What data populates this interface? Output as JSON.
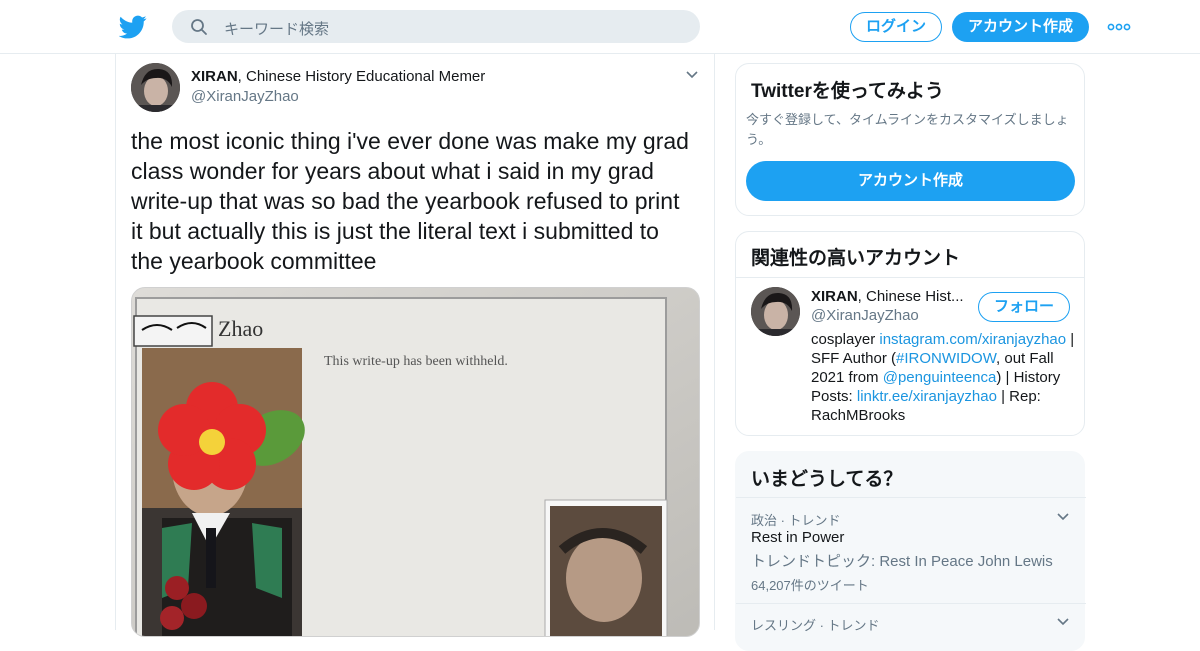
{
  "header": {
    "search_placeholder": "キーワード検索",
    "login_label": "ログイン",
    "signup_label": "アカウント作成",
    "brand_color": "#1da1f2"
  },
  "tweet": {
    "author_name": "XIRAN",
    "author_subtitle": ", Chinese History Educational Memer",
    "author_handle": "@XiranJayZhao",
    "text": "the most iconic thing i've ever done was make my grad class wonder for years about what i said in my grad write-up that was so bad the yearbook refused to print it but actually this is just the literal text i submitted to the yearbook committee",
    "photo": {
      "caption_name": "Zhao",
      "caption_text": "This write-up has been withheld."
    }
  },
  "try_twitter": {
    "title": "Twitterを使ってみよう",
    "description": "今すぐ登録して、タイムラインをカスタマイズしましょう。",
    "button_label": "アカウント作成"
  },
  "related": {
    "title": "関連性の高いアカウント",
    "account": {
      "name": "XIRAN",
      "name_suffix": ", Chinese Hist...",
      "handle": "@XiranJayZhao",
      "follow_label": "フォロー",
      "bio_1": "cosplayer ",
      "bio_link_1": "instagram.com/xiranjayzhao",
      "bio_2": " | SFF Author (",
      "bio_link_2": "#IRONWIDOW",
      "bio_3": ", out Fall 2021 from ",
      "bio_link_3": "@penguinteenca",
      "bio_4": ") | History Posts: ",
      "bio_link_4": "linktr.ee/xiranjayzhao",
      "bio_5": " | Rep: RachMBrooks"
    }
  },
  "trends": {
    "title": "いまどうしてる？",
    "items": [
      {
        "meta": "政治 · トレンド",
        "name": "Rest in Power",
        "topic": "トレンドトピック: Rest In Peace John Lewis",
        "count": "64,207件のツイート"
      },
      {
        "meta": "レスリング · トレンド"
      }
    ]
  }
}
